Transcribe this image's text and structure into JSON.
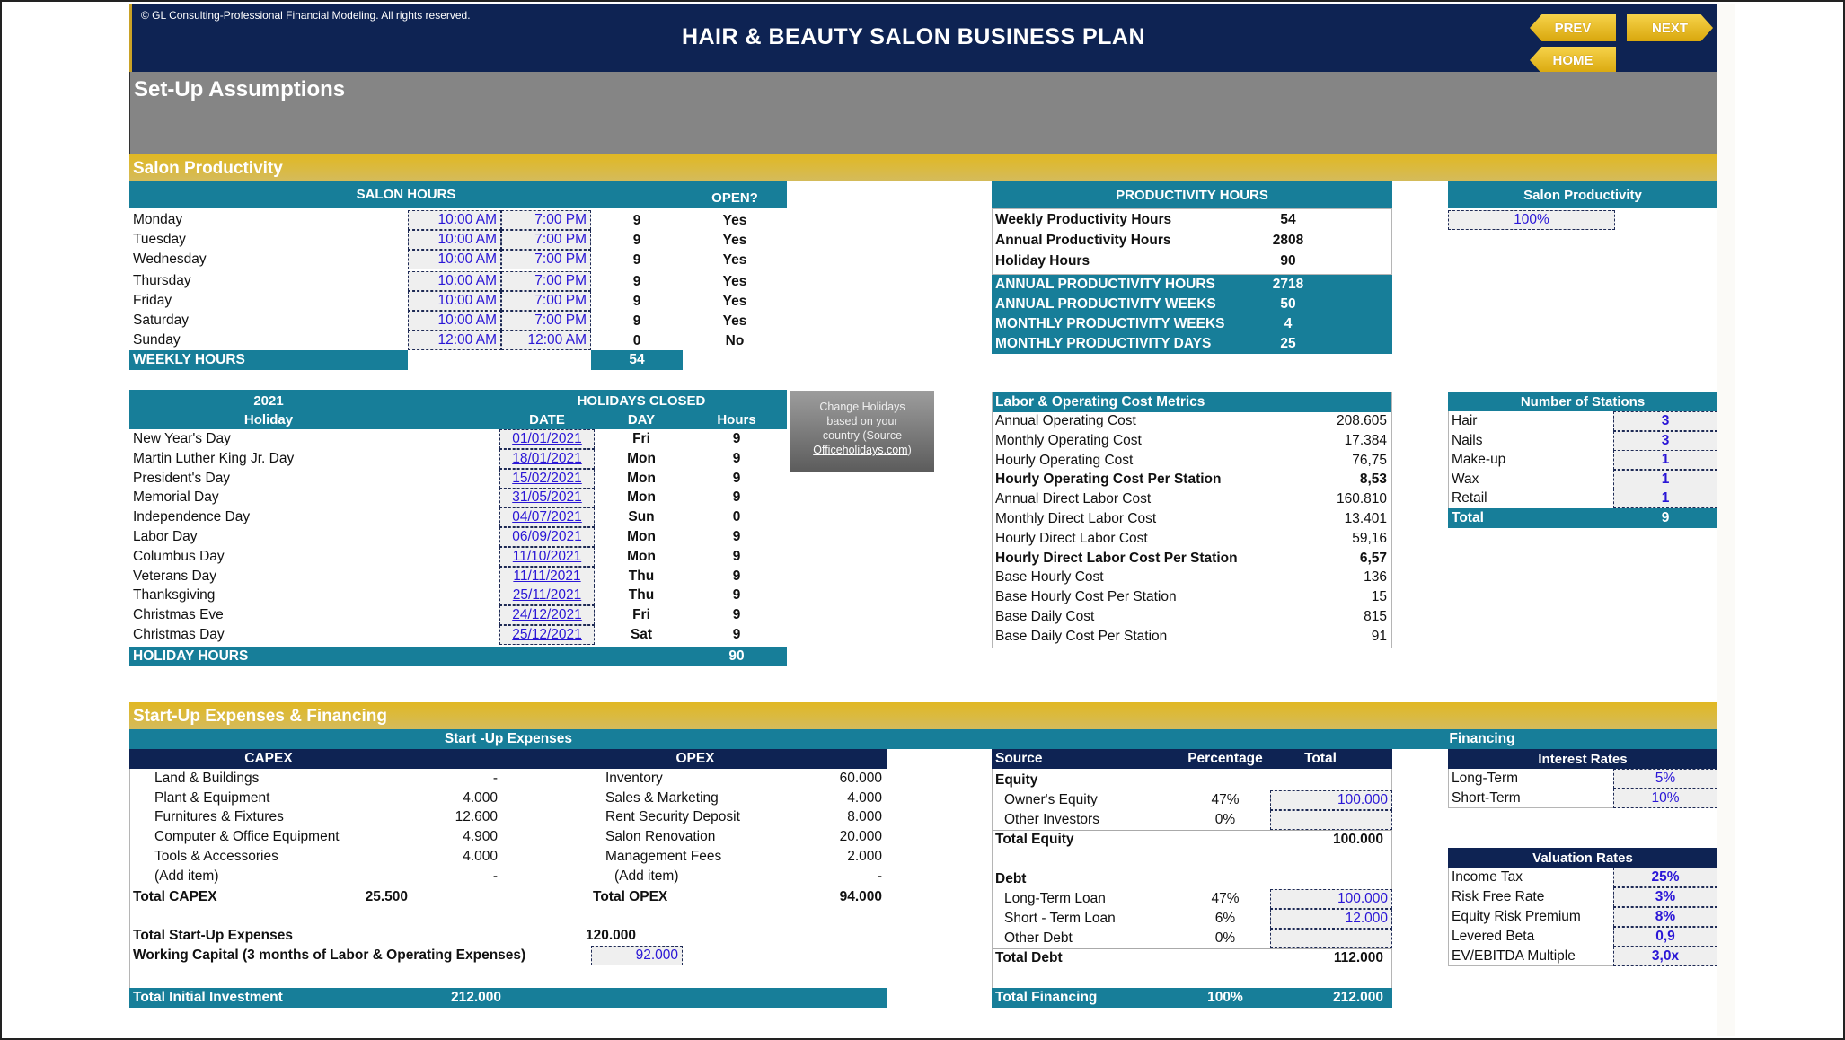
{
  "header": {
    "copyright": "© GL Consulting-Professional Financial Modeling. All rights reserved.",
    "title": "HAIR & BEAUTY SALON BUSINESS PLAN",
    "nav": {
      "prev": "PREV",
      "next": "NEXT",
      "home": "HOME"
    }
  },
  "page_title": "Set-Up Assumptions",
  "colors": {
    "navy": "#0e2353",
    "teal": "#177e99",
    "gold": "#e1b823",
    "input_text": "#2a16d6",
    "gray_band": "#858585"
  },
  "salon_productivity": {
    "section_title": "Salon Productivity",
    "salon_hours": {
      "header": "SALON HOURS",
      "open_header": "OPEN?",
      "days": [
        {
          "day": "Monday",
          "open_time": "10:00 AM",
          "close_time": "7:00 PM",
          "hours": "9",
          "open": "Yes"
        },
        {
          "day": "Tuesday",
          "open_time": "10:00 AM",
          "close_time": "7:00 PM",
          "hours": "9",
          "open": "Yes"
        },
        {
          "day": "Wednesday",
          "open_time": "10:00 AM",
          "close_time": "7:00 PM",
          "hours": "9",
          "open": "Yes"
        },
        {
          "day": "Thursday",
          "open_time": "10:00 AM",
          "close_time": "7:00 PM",
          "hours": "9",
          "open": "Yes"
        },
        {
          "day": "Friday",
          "open_time": "10:00 AM",
          "close_time": "7:00 PM",
          "hours": "9",
          "open": "Yes"
        },
        {
          "day": "Saturday",
          "open_time": "10:00 AM",
          "close_time": "7:00 PM",
          "hours": "9",
          "open": "Yes"
        },
        {
          "day": "Sunday",
          "open_time": "12:00 AM",
          "close_time": "12:00 AM",
          "hours": "0",
          "open": "No"
        }
      ],
      "total_label": "WEEKLY HOURS",
      "total_value": "54"
    },
    "productivity_hours": {
      "header": "PRODUCTIVITY HOURS",
      "rows": [
        {
          "label": "Weekly Productivity Hours",
          "value": "54"
        },
        {
          "label": "Annual Productivity Hours",
          "value": "2808"
        },
        {
          "label": "Holiday Hours",
          "value": "90"
        }
      ],
      "highlight_rows": [
        {
          "label": "ANNUAL PRODUCTIVITY HOURS",
          "value": "2718"
        },
        {
          "label": "ANNUAL PRODUCTIVITY WEEKS",
          "value": "50"
        },
        {
          "label": "MONTHLY PRODUCTIVITY WEEKS",
          "value": "4"
        },
        {
          "label": "MONTHLY PRODUCTIVITY DAYS",
          "value": "25"
        }
      ]
    },
    "salon_productivity_box": {
      "header": "Salon Productivity",
      "value": "100%"
    },
    "holidays": {
      "year": "2021",
      "header": "HOLIDAYS CLOSED",
      "columns": [
        "Holiday",
        "DATE",
        "DAY",
        "Hours"
      ],
      "rows": [
        {
          "name": "New Year's Day",
          "date": "01/01/2021",
          "day": "Fri",
          "hours": "9"
        },
        {
          "name": "Martin Luther King Jr. Day",
          "date": "18/01/2021",
          "day": "Mon",
          "hours": "9"
        },
        {
          "name": "President's Day",
          "date": "15/02/2021",
          "day": "Mon",
          "hours": "9"
        },
        {
          "name": "Memorial Day",
          "date": "31/05/2021",
          "day": "Mon",
          "hours": "9"
        },
        {
          "name": "Independence Day",
          "date": "04/07/2021",
          "day": "Sun",
          "hours": "0"
        },
        {
          "name": "Labor Day",
          "date": "06/09/2021",
          "day": "Mon",
          "hours": "9"
        },
        {
          "name": "Columbus Day",
          "date": "11/10/2021",
          "day": "Mon",
          "hours": "9"
        },
        {
          "name": "Veterans Day",
          "date": "11/11/2021",
          "day": "Thu",
          "hours": "9"
        },
        {
          "name": "Thanksgiving",
          "date": "25/11/2021",
          "day": "Thu",
          "hours": "9"
        },
        {
          "name": "Christmas Eve",
          "date": "24/12/2021",
          "day": "Fri",
          "hours": "9"
        },
        {
          "name": "Christmas Day",
          "date": "25/12/2021",
          "day": "Sat",
          "hours": "9"
        }
      ],
      "total_label": "HOLIDAY HOURS",
      "total_value": "90"
    },
    "change_holidays_button": {
      "line1": "Change Holidays",
      "line2": "based on your",
      "line3": "country (Source",
      "link": "Officeholidays.com",
      "suffix": ")"
    },
    "cost_metrics": {
      "header": "Labor & Operating Cost Metrics",
      "rows": [
        {
          "label": "Annual Operating Cost",
          "value": "208.605",
          "bold": false
        },
        {
          "label": "Monthly Operating Cost",
          "value": "17.384",
          "bold": false
        },
        {
          "label": "Hourly Operating Cost",
          "value": "76,75",
          "bold": false
        },
        {
          "label": "Hourly Operating Cost Per Station",
          "value": "8,53",
          "bold": true
        },
        {
          "label": "Annual Direct Labor Cost",
          "value": "160.810",
          "bold": false
        },
        {
          "label": "Monthly Direct Labor Cost",
          "value": "13.401",
          "bold": false
        },
        {
          "label": "Hourly Direct Labor Cost",
          "value": "59,16",
          "bold": false
        },
        {
          "label": "Hourly Direct Labor Cost Per Station",
          "value": "6,57",
          "bold": true
        },
        {
          "label": "Base Hourly Cost",
          "value": "136",
          "bold": false
        },
        {
          "label": "Base Hourly Cost Per Station",
          "value": "15",
          "bold": false
        },
        {
          "label": "Base Daily Cost",
          "value": "815",
          "bold": false
        },
        {
          "label": "Base Daily Cost Per Station",
          "value": "91",
          "bold": false
        }
      ]
    },
    "stations": {
      "header": "Number of Stations",
      "rows": [
        {
          "label": "Hair",
          "value": "3"
        },
        {
          "label": "Nails",
          "value": "3"
        },
        {
          "label": "Make-up",
          "value": "1"
        },
        {
          "label": "Wax",
          "value": "1"
        },
        {
          "label": "Retail",
          "value": "1"
        }
      ],
      "total_label": "Total",
      "total_value": "9"
    }
  },
  "startup": {
    "section_title": "Start-Up Expenses & Financing",
    "expenses_header": "Start -Up Expenses",
    "capex": {
      "header": "CAPEX",
      "rows": [
        {
          "label": "Land & Buildings",
          "value": "-"
        },
        {
          "label": "Plant & Equipment",
          "value": "4.000"
        },
        {
          "label": "Furnitures & Fixtures",
          "value": "12.600"
        },
        {
          "label": "Computer & Office Equipment",
          "value": "4.900"
        },
        {
          "label": "Tools & Accessories",
          "value": "4.000"
        },
        {
          "label": "(Add item)",
          "value": "-"
        }
      ],
      "total_label": "Total CAPEX",
      "total_value": "25.500"
    },
    "opex": {
      "header": "OPEX",
      "rows": [
        {
          "label": "Inventory",
          "value": "60.000"
        },
        {
          "label": "Sales & Marketing",
          "value": "4.000"
        },
        {
          "label": "Rent Security Deposit",
          "value": "8.000"
        },
        {
          "label": "Salon Renovation",
          "value": "20.000"
        },
        {
          "label": "Management Fees",
          "value": "2.000"
        },
        {
          "label": "(Add item)",
          "value": "-"
        }
      ],
      "total_label": "Total OPEX",
      "total_value": "94.000"
    },
    "total_startup_label": "Total Start-Up Expenses",
    "total_startup_value": "120.000",
    "working_capital_label": "Working Capital (3 months of Labor & Operating Expenses)",
    "working_capital_value": "92.000",
    "total_initial_label": "Total Initial Investment",
    "total_initial_value": "212.000",
    "financing": {
      "header": "Financing",
      "columns": [
        "Source",
        "Percentage",
        "Total"
      ],
      "equity_label": "Equity",
      "equity_rows": [
        {
          "label": "Owner's Equity",
          "pct": "47%",
          "value": "100.000"
        },
        {
          "label": "Other Investors",
          "pct": "0%",
          "value": ""
        }
      ],
      "total_equity_label": "Total Equity",
      "total_equity_value": "100.000",
      "debt_label": "Debt",
      "debt_rows": [
        {
          "label": "Long-Term Loan",
          "pct": "47%",
          "value": "100.000"
        },
        {
          "label": "Short - Term Loan",
          "pct": "6%",
          "value": "12.000"
        },
        {
          "label": "Other Debt",
          "pct": "0%",
          "value": ""
        }
      ],
      "total_debt_label": "Total Debt",
      "total_debt_value": "112.000",
      "total_financing_label": "Total Financing",
      "total_financing_pct": "100%",
      "total_financing_value": "212.000"
    },
    "interest_rates": {
      "header": "Interest Rates",
      "rows": [
        {
          "label": "Long-Term",
          "value": "5%"
        },
        {
          "label": "Short-Term",
          "value": "10%"
        }
      ]
    },
    "valuation_rates": {
      "header": "Valuation Rates",
      "rows": [
        {
          "label": "Income Tax",
          "value": "25%"
        },
        {
          "label": "Risk Free Rate",
          "value": "3%"
        },
        {
          "label": "Equity Risk Premium",
          "value": "8%"
        },
        {
          "label": "Levered Beta",
          "value": "0,9"
        },
        {
          "label": "EV/EBITDA Multiple",
          "value": "3,0x"
        }
      ]
    }
  }
}
